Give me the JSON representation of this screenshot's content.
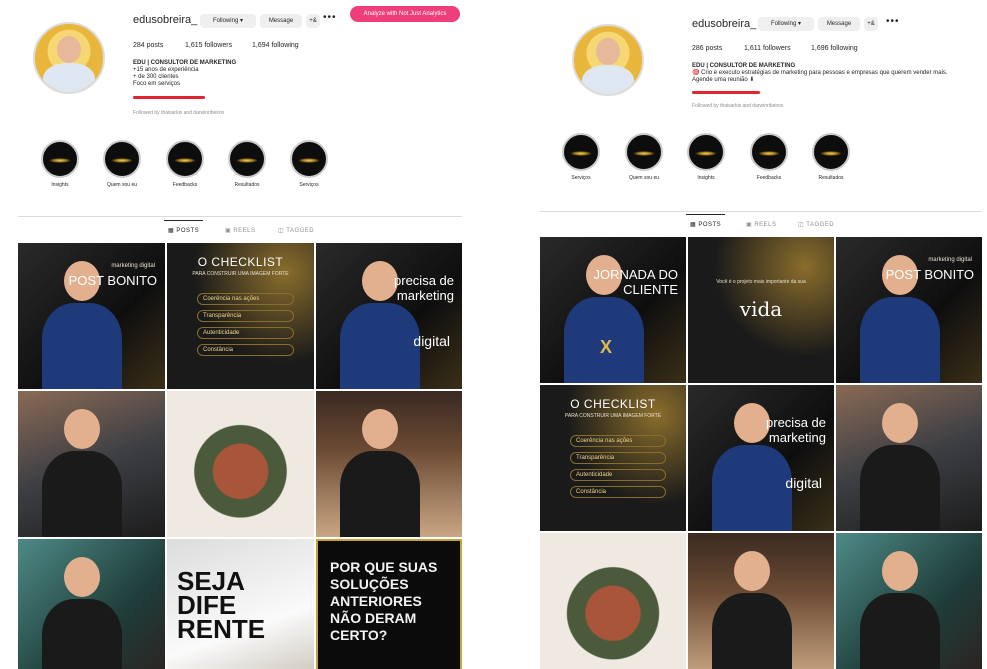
{
  "left": {
    "username": "edusobreira_",
    "following_btn": "Following",
    "message_btn": "Message",
    "add_user_icon": "+&",
    "more_icon": "•••",
    "analyze_btn": "Analyze with Not Just Analytics",
    "stats": {
      "posts": "284 posts",
      "followers": "1,615 followers",
      "following": "1,694 following"
    },
    "bio": [
      "EDU | CONSULTOR DE MARKETING",
      "+15 anos de experiência",
      "+ de 300 clientes",
      "Foco em serviços"
    ],
    "followed_by": "Followed by thaisarkis and darwinribeiros",
    "highlights": [
      "Insights",
      "Quem sou eu",
      "Feedbacks",
      "Resultados",
      "Serviços"
    ],
    "tabs": [
      "POSTS",
      "REELS",
      "TAGGED"
    ],
    "tiles": [
      {
        "kind": "t-dark",
        "caption": "POST BONITO",
        "sub": "marketing digital"
      },
      {
        "kind": "t-gold",
        "caption": "O CHECKLIST",
        "sub": "PARA CONSTRUIR UMA IMAGEM FORTE",
        "items": [
          "Coerência nas ações",
          "Transparência",
          "Autenticidade",
          "Constância"
        ]
      },
      {
        "kind": "t-dark",
        "caption": "precisa de marketing",
        "sub": "digital"
      },
      {
        "kind": "t-photo1",
        "caption": ""
      },
      {
        "kind": "t-food",
        "caption": ""
      },
      {
        "kind": "t-theatre",
        "caption": ""
      },
      {
        "kind": "t-cafe",
        "caption": ""
      },
      {
        "kind": "t-diff",
        "caption": "SEJA DIFE RENTE"
      },
      {
        "kind": "t-black",
        "caption": "POR QUE SUAS SOLUÇÕES ANTERIORES NÃO DERAM CERTO?"
      }
    ]
  },
  "right": {
    "username": "edusobreira_",
    "following_btn": "Following",
    "message_btn": "Message",
    "add_user_icon": "+&",
    "more_icon": "•••",
    "stats": {
      "posts": "286 posts",
      "followers": "1,611 followers",
      "following": "1,696 following"
    },
    "bio": [
      "EDU | CONSULTOR DE MARKETING",
      "🎯 Crio e executo estratégias de marketing para pessoas e empresas que querem vender mais.",
      "Agende uma reunião ⬇"
    ],
    "followed_by": "Followed by thaisarkis and darwinribeiros",
    "highlights": [
      "Serviços",
      "Quem sou eu",
      "Insights",
      "Feedbacks",
      "Resultados"
    ],
    "tabs": [
      "POSTS",
      "REELS",
      "TAGGED"
    ],
    "tiles": [
      {
        "kind": "t-dark",
        "caption": "JORNADA DO CLIENTE",
        "sub": "X"
      },
      {
        "kind": "t-gold",
        "caption": "vida",
        "sub": "Você é o projeto mais importante da sua"
      },
      {
        "kind": "t-dark",
        "caption": "POST BONITO",
        "sub": "marketing digital"
      },
      {
        "kind": "t-gold",
        "caption": "O CHECKLIST",
        "sub": "PARA CONSTRUIR UMA IMAGEM FORTE",
        "items": [
          "Coerência nas ações",
          "Transparência",
          "Autenticidade",
          "Constância"
        ]
      },
      {
        "kind": "t-dark",
        "caption": "precisa de marketing",
        "sub": "digital"
      },
      {
        "kind": "t-photo1",
        "caption": ""
      },
      {
        "kind": "t-food",
        "caption": ""
      },
      {
        "kind": "t-theatre",
        "caption": ""
      },
      {
        "kind": "t-cafe",
        "caption": ""
      }
    ]
  }
}
